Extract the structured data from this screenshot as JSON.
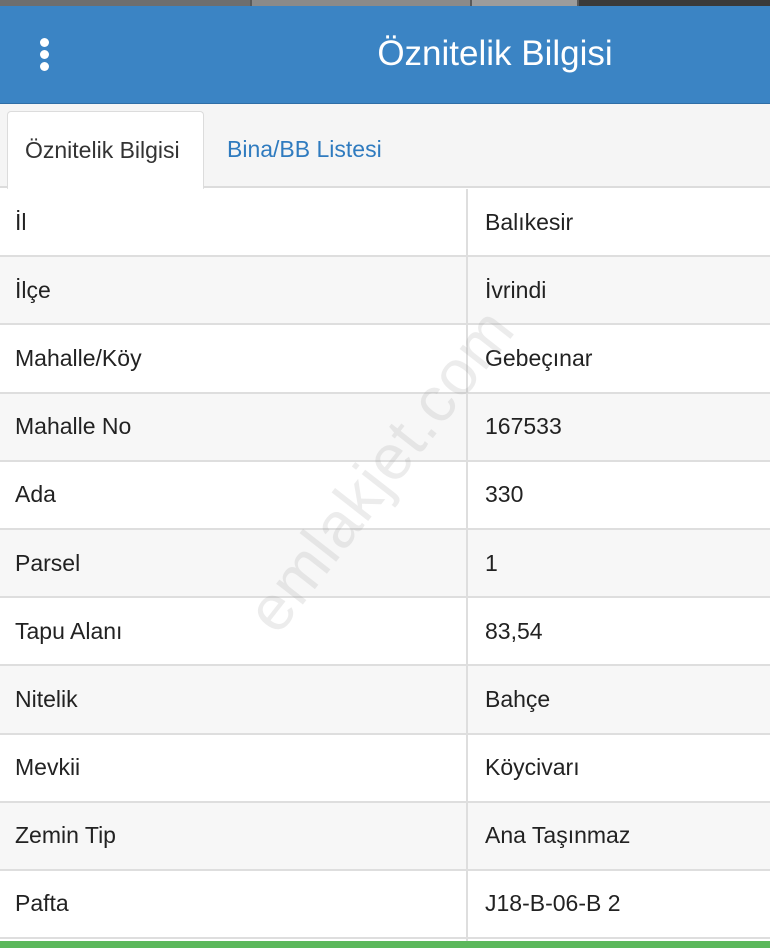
{
  "header": {
    "title": "Öznitelik Bilgisi",
    "menu_icon": "more-vertical-icon",
    "background_color": "#3b84c4"
  },
  "tabs": [
    {
      "label": "Öznitelik Bilgisi",
      "active": true
    },
    {
      "label": "Bina/BB Listesi",
      "active": false
    }
  ],
  "attributes": [
    {
      "key": "İl",
      "value": "Balıkesir"
    },
    {
      "key": "İlçe",
      "value": "İvrindi"
    },
    {
      "key": "Mahalle/Köy",
      "value": "Gebeçınar"
    },
    {
      "key": "Mahalle No",
      "value": "167533"
    },
    {
      "key": "Ada",
      "value": "330"
    },
    {
      "key": "Parsel",
      "value": "1"
    },
    {
      "key": "Tapu Alanı",
      "value": "83,54"
    },
    {
      "key": "Nitelik",
      "value": "Bahçe"
    },
    {
      "key": "Mevkii",
      "value": "Köycivarı"
    },
    {
      "key": "Zemin Tip",
      "value": "Ana Taşınmaz"
    },
    {
      "key": "Pafta",
      "value": "J18-B-06-B 2"
    }
  ],
  "watermark": "emlakjet.com",
  "colors": {
    "accent": "#3b84c4",
    "link": "#2f7bbf",
    "footer": "#5cb85c"
  }
}
